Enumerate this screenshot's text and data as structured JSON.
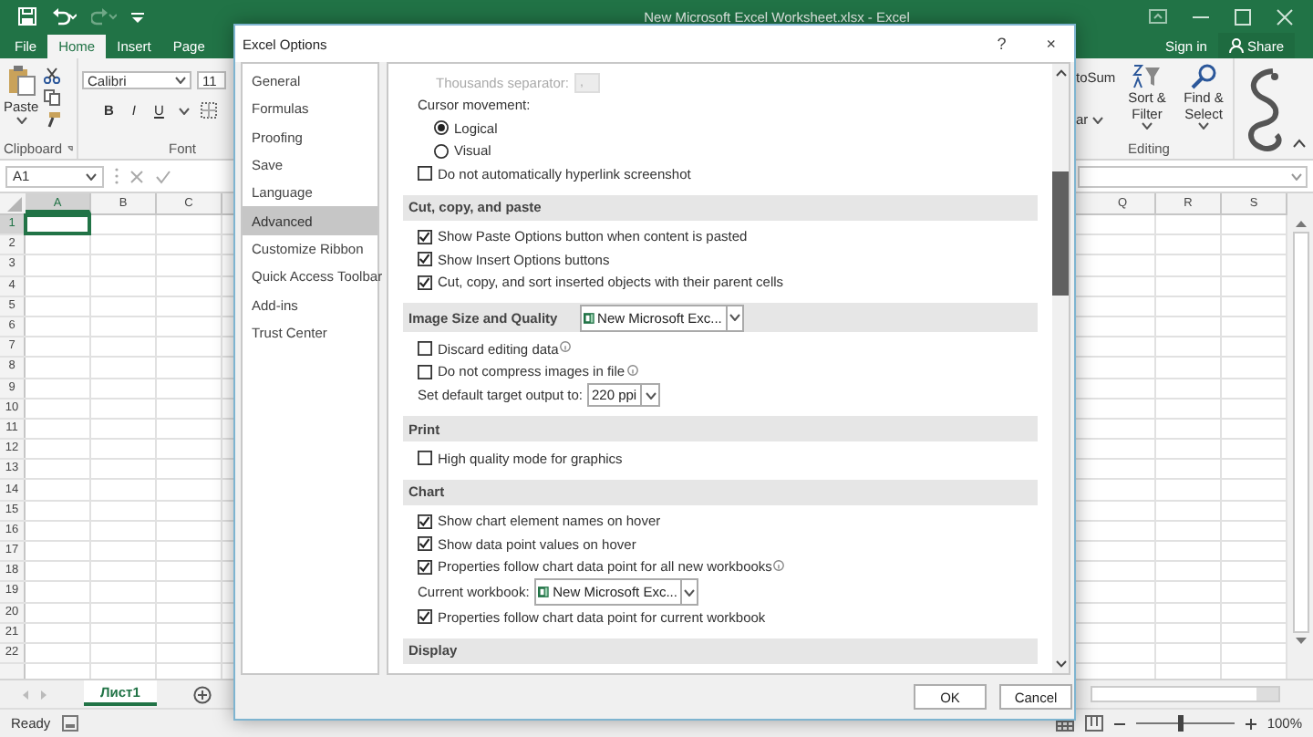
{
  "window": {
    "title": "New Microsoft Excel Worksheet.xlsx - Excel",
    "sign_in": "Sign in",
    "share": "Share"
  },
  "ribbon_tabs": [
    {
      "label": "File",
      "selected": false
    },
    {
      "label": "Home",
      "selected": true
    },
    {
      "label": "Insert",
      "selected": false
    },
    {
      "label": "Page",
      "selected": false
    }
  ],
  "ribbon": {
    "paste": "Paste",
    "clipboard": "Clipboard",
    "font_name": "Calibri",
    "font_size": "11",
    "bold": "B",
    "italic": "I",
    "underline": "U",
    "font": "Font",
    "autosum": "toSum",
    "clear": "ar",
    "sort_filter": "Sort & Filter",
    "find_select": "Find & Select",
    "editing": "Editing"
  },
  "name_box": "A1",
  "grid": {
    "left_columns": [
      "A",
      "B",
      "C"
    ],
    "right_columns": [
      "Q",
      "R",
      "S"
    ],
    "rows": [
      "1",
      "2",
      "3",
      "4",
      "5",
      "6",
      "7",
      "8",
      "9",
      "10",
      "11",
      "12",
      "13",
      "14",
      "15",
      "16",
      "17",
      "18",
      "19",
      "20",
      "21",
      "22"
    ]
  },
  "sheet_tabs": [
    {
      "label": "Лист1",
      "selected": true
    }
  ],
  "status_bar": {
    "status": "Ready",
    "zoom": "100%",
    "zoom_slider": {
      "level": 0.45
    }
  },
  "dialog": {
    "title": "Excel Options",
    "help": "?",
    "close": "×",
    "nav": [
      {
        "label": "General",
        "selected": false
      },
      {
        "label": "Formulas",
        "selected": false
      },
      {
        "label": "Proofing",
        "selected": false
      },
      {
        "label": "Save",
        "selected": false
      },
      {
        "label": "Language",
        "selected": false
      },
      {
        "label": "Advanced",
        "selected": true
      },
      {
        "label": "Customize Ribbon",
        "selected": false
      },
      {
        "label": "Quick Access Toolbar",
        "selected": false
      },
      {
        "label": "Add-ins",
        "selected": false
      },
      {
        "label": "Trust Center",
        "selected": false
      }
    ],
    "settings": [
      {
        "kind": "field",
        "label": "Thousands separator:",
        "value": ",",
        "disabled": true
      },
      {
        "kind": "label",
        "label": "Cursor movement:"
      },
      {
        "kind": "radio",
        "label": "Logical",
        "selected": true
      },
      {
        "kind": "radio",
        "label": "Visual",
        "selected": false
      },
      {
        "kind": "checkbox",
        "label": "Do not automatically hyperlink screenshot",
        "checked": false
      },
      {
        "kind": "section",
        "label": "Cut, copy, and paste"
      },
      {
        "kind": "checkbox",
        "label": "Show Paste Options button when content is pasted",
        "checked": true
      },
      {
        "kind": "checkbox",
        "label": "Show Insert Options buttons",
        "checked": true
      },
      {
        "kind": "checkbox",
        "label": "Cut, copy, and sort inserted objects with their parent cells",
        "checked": true
      },
      {
        "kind": "section",
        "label": "Image Size and Quality",
        "dropdown": {
          "value": "New Microsoft Exc...",
          "excel_icon": true
        }
      },
      {
        "kind": "checkbox",
        "label": "Discard editing data",
        "checked": false,
        "info": true
      },
      {
        "kind": "checkbox",
        "label": "Do not compress images in file",
        "checked": false,
        "info": true
      },
      {
        "kind": "dropdown",
        "label": "Set default target output to:",
        "value": "220 ppi"
      },
      {
        "kind": "section",
        "label": "Print"
      },
      {
        "kind": "checkbox",
        "label": "High quality mode for graphics",
        "checked": false
      },
      {
        "kind": "section",
        "label": "Chart"
      },
      {
        "kind": "checkbox",
        "label": "Show chart element names on hover",
        "checked": true
      },
      {
        "kind": "checkbox",
        "label": "Show data point values on hover",
        "checked": true
      },
      {
        "kind": "checkbox",
        "label": "Properties follow chart data point for all new workbooks",
        "checked": true,
        "info": true
      },
      {
        "kind": "dropdown",
        "label": "Current workbook:",
        "value": "New Microsoft Exc...",
        "excel_icon": true
      },
      {
        "kind": "checkbox",
        "label": "Properties follow chart data point for current workbook",
        "checked": true
      },
      {
        "kind": "section",
        "label": "Display"
      }
    ],
    "buttons": [
      "OK",
      "Cancel"
    ]
  }
}
